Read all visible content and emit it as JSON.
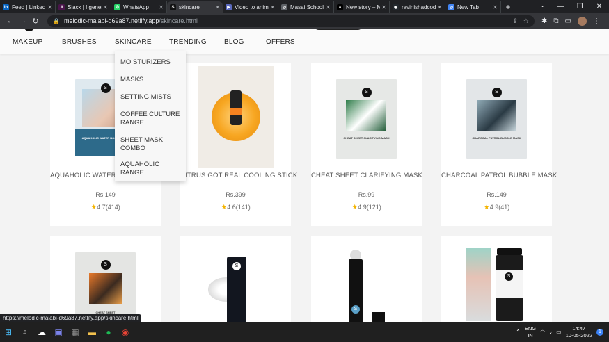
{
  "browser": {
    "tabs": [
      {
        "label": "Feed | LinkedIn",
        "icon": "linkedin-icon",
        "color": "#0a66c2",
        "glyph": "in"
      },
      {
        "label": "Slack | ! general",
        "icon": "slack-icon",
        "color": "#4a154b",
        "glyph": "#"
      },
      {
        "label": "WhatsApp",
        "icon": "whatsapp-icon",
        "color": "#25d366",
        "glyph": "✆"
      },
      {
        "label": "skincare",
        "icon": "sugar-icon",
        "color": "#111111",
        "glyph": "S"
      },
      {
        "label": "Video to anim",
        "icon": "video-icon",
        "color": "#5b6abf",
        "glyph": "▶"
      },
      {
        "label": "Masai School",
        "icon": "globe-icon",
        "color": "#5f6368",
        "glyph": "◎"
      },
      {
        "label": "New story – M",
        "icon": "medium-icon",
        "color": "#000000",
        "glyph": "●"
      },
      {
        "label": "ravinishadcod",
        "icon": "github-icon",
        "color": "#24292e",
        "glyph": "◉"
      },
      {
        "label": "New Tab",
        "icon": "chrome-icon",
        "color": "#4285f4",
        "glyph": "◎"
      }
    ],
    "new_tab": "+",
    "url_host": "melodic-malabi-d69a87.netlify.app",
    "url_path": "/skincare.html",
    "status_url": "https://melodic-malabi-d69a87.netlify.app/skincare.html"
  },
  "site": {
    "nav": [
      "MAKEUP",
      "BRUSHES",
      "SKINCARE",
      "TRENDING",
      "BLOG",
      "OFFERS"
    ],
    "dropdown": [
      "MOISTURIZERS",
      "MASKS",
      "SETTING MISTS",
      "COFFEE CULTURE RANGE",
      "SHEET MASK COMBO",
      "AQUAHOLIC RANGE"
    ],
    "products": [
      {
        "title": "AQUAHOLIC WATER BOOST MASK",
        "price": "Rs.149",
        "rating": "4.7(414)",
        "mask_title": "AQUAHOLIC WATER BOOST MASK"
      },
      {
        "title": "CITRUS GOT REAL COOLING STICK",
        "price": "Rs.399",
        "rating": "4.6(141)"
      },
      {
        "title": "CHEAT SHEET CLARIFYING MASK",
        "price": "Rs.99",
        "rating": "4.9(121)",
        "mask_title": "CHEAT SHEET CLARIFYING MASK"
      },
      {
        "title": "CHARCOAL PATROL BUBBLE MASK",
        "price": "Rs.149",
        "rating": "4.9(41)",
        "mask_title": "CHARCOAL PATROL BUBBLE MASK"
      }
    ],
    "row2_mask_title": "CHEAT SHEET",
    "brand_mark": "SUGAR"
  },
  "taskbar": {
    "lang": "ENG",
    "region": "IN",
    "time": "14:47",
    "date": "10-05-2022",
    "notifications": "1"
  }
}
